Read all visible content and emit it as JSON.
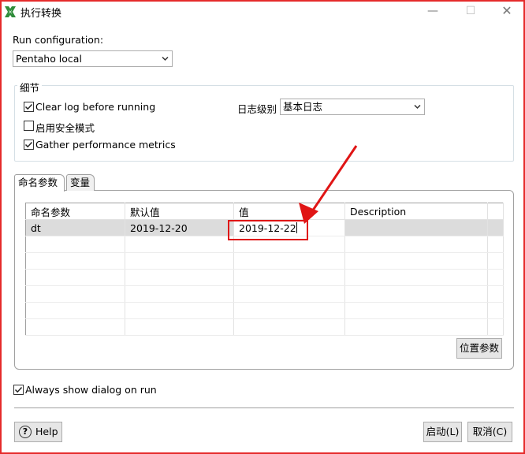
{
  "window": {
    "title": "执行转换",
    "min_symbol": "—",
    "max_symbol": "☐",
    "close_symbol": "✕"
  },
  "run_config": {
    "label": "Run configuration:",
    "selected": "Pentaho local"
  },
  "details": {
    "title": "细节",
    "clear_log": {
      "label": "Clear log before running",
      "checked": true
    },
    "safe_mode": {
      "label": "启用安全模式",
      "checked": false
    },
    "gather_metrics": {
      "label": "Gather performance metrics",
      "checked": true
    },
    "log_level_label": "日志级别",
    "log_level_value": "基本日志"
  },
  "tabs": [
    {
      "label": "命名参数",
      "active": true
    },
    {
      "label": "变量",
      "active": false
    }
  ],
  "params_table": {
    "columns": [
      "命名参数",
      "默认值",
      "值",
      "Description"
    ],
    "rows": [
      {
        "name": "dt",
        "default": "2019-12-20",
        "value": "2019-12-22",
        "description": ""
      }
    ]
  },
  "position_params_button": "位置参数",
  "always_show": {
    "label": "Always show dialog on run",
    "checked": true
  },
  "buttons": {
    "help": "Help",
    "help_icon_glyph": "?",
    "start": "启动(L)",
    "cancel": "取消(C)"
  },
  "annotation": {
    "color": "#e01515"
  }
}
